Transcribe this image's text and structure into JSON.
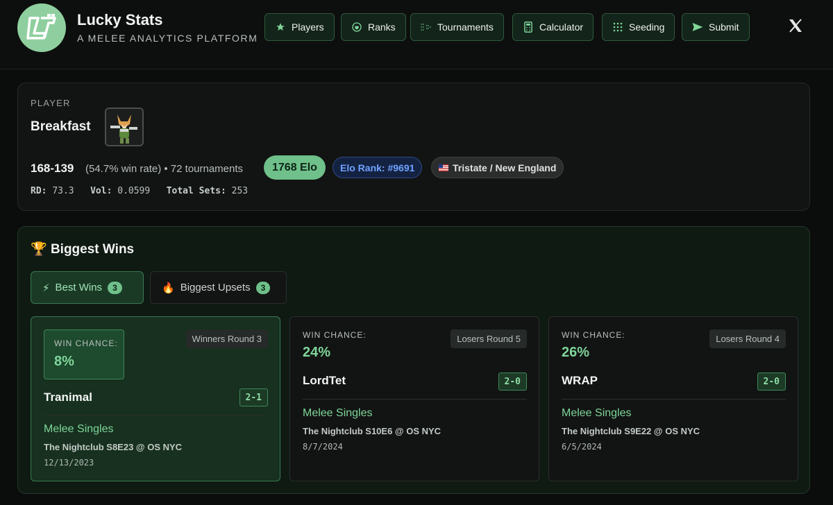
{
  "header": {
    "brand_title": "Lucky Stats",
    "brand_subtitle": "A MELEE ANALYTICS PLATFORM",
    "nav": [
      {
        "label": "Players",
        "icon": "star-icon"
      },
      {
        "label": "Ranks",
        "icon": "trophy-icon"
      },
      {
        "label": "Tournaments",
        "icon": "bracket-icon"
      },
      {
        "label": "Calculator",
        "icon": "calculator-icon"
      },
      {
        "label": "Seeding",
        "icon": "grid-icon"
      },
      {
        "label": "Submit",
        "icon": "send-icon"
      }
    ],
    "x_icon_glyph": "𝕏"
  },
  "player": {
    "section_label": "PLAYER",
    "name": "Breakfast",
    "record": "168-139",
    "winrate_text": "(54.7% win rate) • 72 tournaments",
    "elo": "1768 Elo",
    "elo_rank": "Elo Rank: #9691",
    "region": "Tristate / New England",
    "stats": {
      "rd_label": "RD:",
      "rd": "73.3",
      "vol_label": "Vol:",
      "vol": "0.0599",
      "sets_label": "Total Sets:",
      "sets": "253"
    }
  },
  "wins": {
    "title_emoji": "🏆",
    "title": "Biggest Wins",
    "tabs": [
      {
        "emoji": "⚡",
        "label": "Best Wins",
        "count": "3",
        "active": true
      },
      {
        "emoji": "🔥",
        "label": "Biggest Upsets",
        "count": "3",
        "active": false
      }
    ],
    "chance_label": "WIN CHANCE:",
    "matches": [
      {
        "chance": "8%",
        "round": "Winners Round 3",
        "opponent": "Tranimal",
        "score": "2-1",
        "event": "Melee Singles",
        "tournament": "The Nightclub S8E23 @ OS NYC",
        "date": "12/13/2023"
      },
      {
        "chance": "24%",
        "round": "Losers Round 5",
        "opponent": "LordTet",
        "score": "2-0",
        "event": "Melee Singles",
        "tournament": "The Nightclub S10E6 @ OS NYC",
        "date": "8/7/2024"
      },
      {
        "chance": "26%",
        "round": "Losers Round 4",
        "opponent": "WRAP",
        "score": "2-0",
        "event": "Melee Singles",
        "tournament": "The Nightclub S9E22 @ OS NYC",
        "date": "6/5/2024"
      }
    ]
  }
}
